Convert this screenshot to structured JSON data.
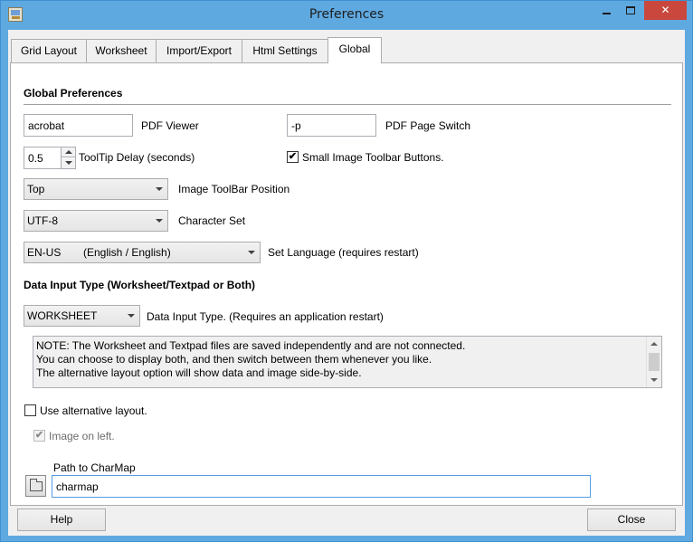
{
  "window": {
    "title": "Preferences",
    "close_glyph": "✕"
  },
  "tabs": [
    {
      "label": "Grid Layout"
    },
    {
      "label": "Worksheet"
    },
    {
      "label": "Import/Export"
    },
    {
      "label": "Html Settings"
    },
    {
      "label": "Global",
      "active": true
    }
  ],
  "global": {
    "section_title": "Global Preferences",
    "pdf_viewer": {
      "value": "acrobat",
      "label": "PDF Viewer"
    },
    "pdf_page_switch": {
      "value": "-p",
      "label": "PDF Page Switch"
    },
    "tooltip_delay": {
      "value": "0.5",
      "label": "ToolTip Delay (seconds)"
    },
    "small_toolbar": {
      "checked": true,
      "label": "Small Image Toolbar Buttons."
    },
    "toolbar_position": {
      "value": "Top",
      "label": "Image ToolBar Position"
    },
    "character_set": {
      "value": "UTF-8",
      "label": "Character Set"
    },
    "language": {
      "code": "EN-US",
      "name": "(English / English)",
      "label": "Set Language (requires restart)"
    },
    "data_input_section_title": "Data Input Type (Worksheet/Textpad or Both)",
    "data_input_type": {
      "value": "WORKSHEET",
      "label": "Data Input Type. (Requires an application restart)"
    },
    "note_lines": [
      "NOTE: The Worksheet and Textpad files are saved independently and are not connected.",
      "You can choose to display both, and then switch between them whenever you like.",
      "The alternative layout option will show data and image side-by-side."
    ],
    "use_alt_layout": {
      "checked": false,
      "label": "Use alternative layout."
    },
    "image_on_left": {
      "checked": true,
      "disabled": true,
      "label": "Image on left."
    },
    "charmap": {
      "label": "Path to CharMap",
      "value": "charmap"
    }
  },
  "footer": {
    "help_label": "Help",
    "close_label": "Close"
  },
  "icons": {
    "check_glyph": "✔",
    "folder": "folder-icon"
  },
  "colors": {
    "titlebar": "#5fa9e1",
    "close_button": "#c9473c",
    "panel_bg": "#f0f0f0"
  }
}
